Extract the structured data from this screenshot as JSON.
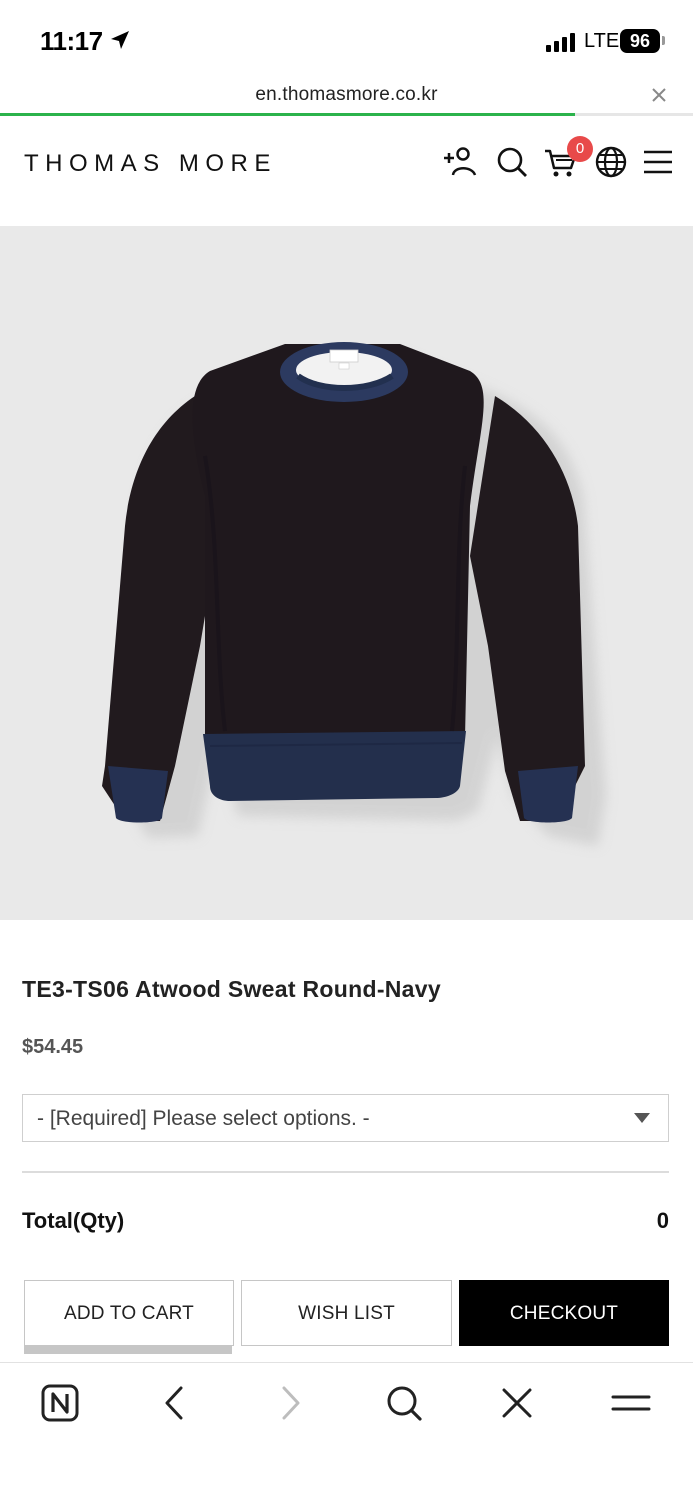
{
  "status_bar": {
    "time": "11:17",
    "network": "LTE",
    "battery": "96"
  },
  "browser": {
    "url": "en.thomasmore.co.kr",
    "load_progress_percent": 83,
    "progress_color": "#2bb34b"
  },
  "header": {
    "logo": "THOMAS MORE",
    "cart_count": "0",
    "icons": [
      "add-user-icon",
      "search-icon",
      "cart-icon",
      "globe-icon",
      "menu-icon"
    ],
    "badge_color": "#e84a4a"
  },
  "product": {
    "title": "TE3-TS06 Atwood Sweat Round-Navy",
    "price": "$54.45",
    "option_placeholder": "- [Required] Please select options. -",
    "total_label": "Total(Qty)",
    "total_value": "0"
  },
  "actions": {
    "add_to_cart": "ADD TO CART",
    "wish_list": "WISH LIST",
    "checkout": "CHECKOUT"
  },
  "toolbar": {
    "icons": [
      "naver-home-icon",
      "back-icon",
      "forward-icon",
      "search-icon",
      "close-icon",
      "menu-icon"
    ]
  }
}
